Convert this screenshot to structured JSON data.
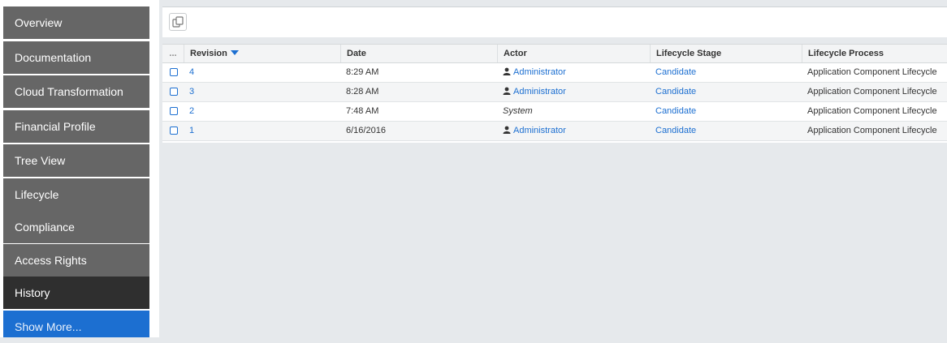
{
  "sidebar": {
    "items": [
      {
        "label": "Overview"
      },
      {
        "label": "Documentation"
      },
      {
        "label": "Cloud Transformation"
      },
      {
        "label": "Financial Profile"
      },
      {
        "label": "Tree View"
      },
      {
        "label": "Lifecycle"
      },
      {
        "label": "Compliance"
      },
      {
        "label": "Access Rights"
      },
      {
        "label": "History",
        "active": true
      },
      {
        "label": "Show More..."
      }
    ]
  },
  "toolbar": {
    "copy_icon": "copy-icon"
  },
  "table": {
    "select_header": "...",
    "columns": [
      "Revision",
      "Date",
      "Actor",
      "Lifecycle Stage",
      "Lifecycle Process"
    ],
    "sort": {
      "column": "Revision",
      "direction": "descending"
    },
    "rows": [
      {
        "revision": "4",
        "date": "8:29 AM",
        "actor": "Administrator",
        "stage": "Candidate",
        "process": "Application Component Lifecycle"
      },
      {
        "revision": "3",
        "date": "8:28 AM",
        "actor": "Administrator",
        "stage": "Candidate",
        "process": "Application Component Lifecycle"
      },
      {
        "revision": "2",
        "date": "7:48 AM",
        "actor": "System",
        "stage": "Candidate",
        "process": "Application Component Lifecycle"
      },
      {
        "revision": "1",
        "date": "6/16/2016",
        "actor": "Administrator",
        "stage": "Candidate",
        "process": "Application Component Lifecycle"
      }
    ]
  },
  "colors": {
    "accent": "#1c6fd1",
    "nav": "#666666",
    "nav_active": "#2f2f2f"
  }
}
